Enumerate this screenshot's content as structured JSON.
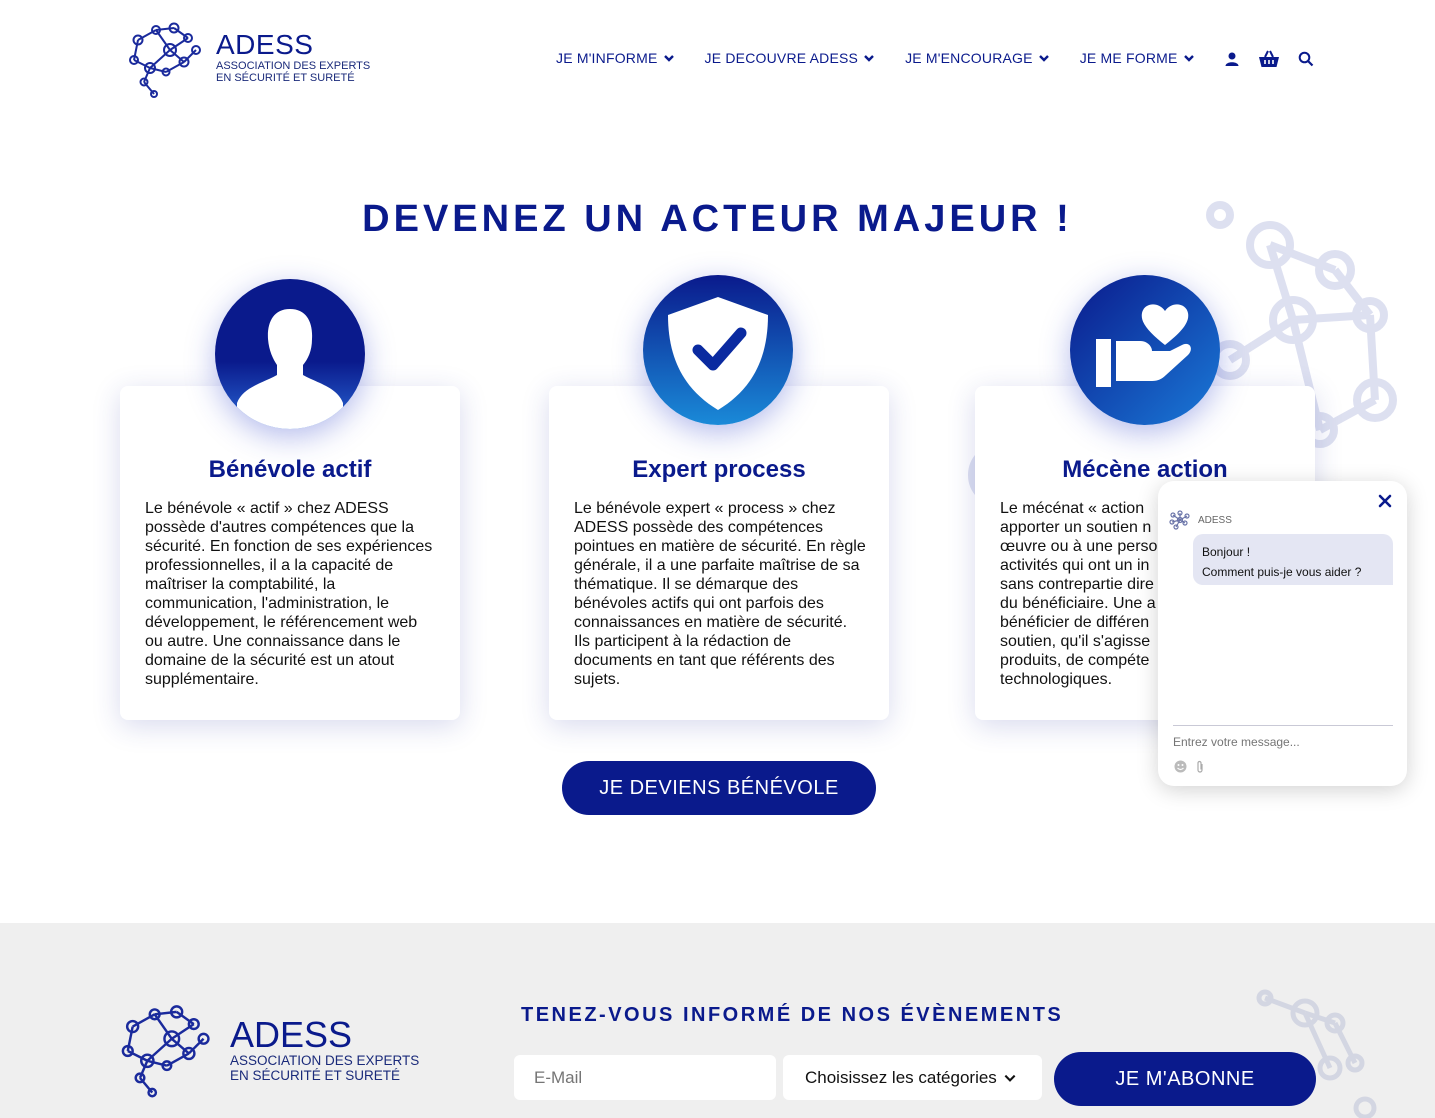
{
  "header": {
    "logo": {
      "title": "ADESS",
      "subtitle_line1": "Association des Experts",
      "subtitle_line2": "en Sécurité et Sureté"
    },
    "nav": [
      {
        "label": "JE M'INFORME"
      },
      {
        "label": "JE DECOUVRE ADESS"
      },
      {
        "label": "JE M'ENCOURAGE"
      },
      {
        "label": "JE ME FORME"
      }
    ],
    "icons": [
      "user-icon",
      "basket-icon",
      "search-icon"
    ]
  },
  "main": {
    "title": "DEVENEZ UN ACTEUR MAJEUR !",
    "cards": [
      {
        "title": "Bénévole actif",
        "icon": "person-icon",
        "text": "Le bénévole « actif » chez ADESS possède d'autres compétences que la sécurité. En fonction de ses expériences professionnelles, il a la capacité de maîtriser la comptabilité, la communication, l'administration, le développement, le référencement web ou autre. Une connaissance dans le domaine de la sécurité est un atout supplémentaire."
      },
      {
        "title": "Expert process",
        "icon": "shield-check-icon",
        "text": "Le bénévole expert « process » chez ADESS possède des compétences pointues en matière de sécurité. En règle générale, il a une parfaite maîtrise de sa thématique. Il se démarque des bénévoles actifs qui ont parfois des connaissances en matière de sécurité. Ils participent à la rédaction de documents en tant que référents des sujets."
      },
      {
        "title": "Mécène action",
        "icon": "heart-hand-icon",
        "text": "Le mécénat « action apporter un soutien n œuvre ou à une perso activités qui ont un in sans contrepartie dire du bénéficiaire. Une a bénéficier de différen soutien, qu'il s'agisse produits, de compéte technologiques."
      }
    ],
    "cta_label": "JE DEVIENS BÉNÉVOLE"
  },
  "chat": {
    "brand": "ADESS",
    "greeting_line1": "Bonjour !",
    "greeting_line2": "Comment puis-je vous aider ?",
    "input_placeholder": "Entrez votre message..."
  },
  "footer": {
    "logo": {
      "title": "ADESS",
      "subtitle_line1": "Association des Experts",
      "subtitle_line2": "en Sécurité et Sureté"
    },
    "newsletter_title": "TENEZ-VOUS INFORMÉ DE NOS ÉVÈNEMENTS",
    "email_placeholder": "E-Mail",
    "category_select": "Choisissez les catégories",
    "subscribe_label": "JE M'ABONNE"
  },
  "colors": {
    "brand": "#0a1a8c",
    "footer_bg": "#efefef",
    "chat_bubble": "#e4e6f3"
  }
}
